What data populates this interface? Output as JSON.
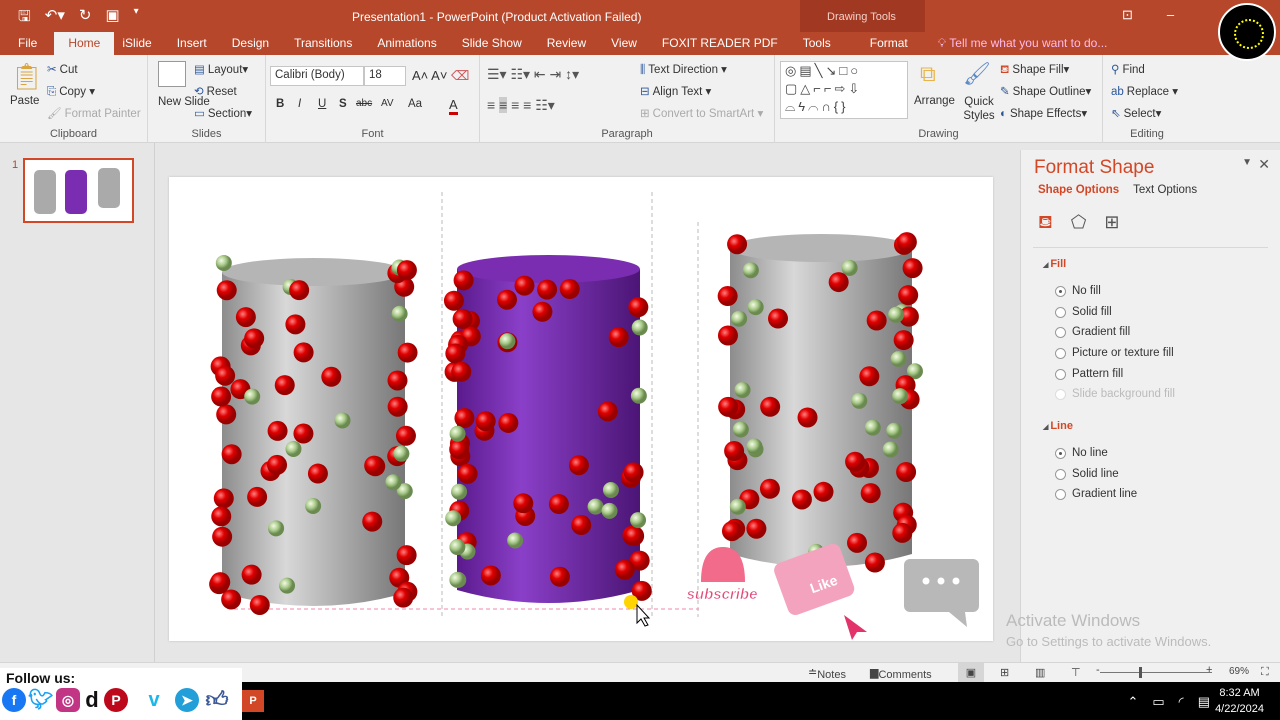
{
  "window": {
    "title": "Presentation1 - PowerPoint (Product Activation Failed)",
    "context_tab_group": "Drawing Tools"
  },
  "tabs": [
    "File",
    "Home",
    "iSlide",
    "Insert",
    "Design",
    "Transitions",
    "Animations",
    "Slide Show",
    "Review",
    "View",
    "FOXIT READER PDF",
    "Tools",
    "Format"
  ],
  "active_tab": "Home",
  "tell_me": "Tell me what you want to do...",
  "ribbon": {
    "clipboard": {
      "label": "Clipboard",
      "paste": "Paste",
      "cut": "Cut",
      "copy": "Copy",
      "format_painter": "Format Painter"
    },
    "slides": {
      "label": "Slides",
      "new_slide": "New Slide",
      "layout": "Layout",
      "reset": "Reset",
      "section": "Section"
    },
    "font": {
      "label": "Font",
      "font_name": "Calibri (Body)",
      "font_size": "18",
      "bold": "B",
      "italic": "I",
      "underline": "U",
      "shadow": "S",
      "strike": "abc",
      "spacing": "AV",
      "case": "Aa",
      "color": "A"
    },
    "paragraph": {
      "label": "Paragraph",
      "text_direction": "Text Direction",
      "align_text": "Align Text",
      "convert_smartart": "Convert to SmartArt"
    },
    "drawing": {
      "label": "Drawing",
      "arrange": "Arrange",
      "quick_styles": "Quick Styles",
      "shape_fill": "Shape Fill",
      "shape_outline": "Shape Outline",
      "shape_effects": "Shape Effects"
    },
    "editing": {
      "label": "Editing",
      "find": "Find",
      "replace": "Replace",
      "select": "Select"
    }
  },
  "thumbnails": [
    {
      "number": "1"
    }
  ],
  "slide": {
    "subscribe": "subscribe",
    "like": "Like",
    "cylinder_colors": [
      "#a9a9a9",
      "#7a2db0",
      "#a9a9a9"
    ]
  },
  "format_panel": {
    "title": "Format Shape",
    "tabs": [
      "Shape Options",
      "Text Options"
    ],
    "active_tab": "Shape Options",
    "fill": {
      "label": "Fill",
      "options": [
        "No fill",
        "Solid fill",
        "Gradient fill",
        "Picture or texture fill",
        "Pattern fill",
        "Slide background fill"
      ],
      "selected": "No fill",
      "disabled": [
        "Slide background fill"
      ]
    },
    "line": {
      "label": "Line",
      "options": [
        "No line",
        "Solid line",
        "Gradient line"
      ],
      "selected": "No line"
    }
  },
  "watermark": {
    "line1": "Activate Windows",
    "line2": "Go to Settings to activate Windows."
  },
  "statusbar": {
    "notes": "Notes",
    "comments": "Comments",
    "zoom": "69%"
  },
  "overlay": {
    "follow": "Follow us:",
    "networks": [
      "facebook",
      "twitter",
      "instagram",
      "dailymotion",
      "pinterest",
      "vimeo",
      "telegram",
      "like"
    ]
  },
  "taskbar": {
    "time": "8:32 AM",
    "date": "4/22/2024"
  },
  "colors": {
    "accent": "#b7472a",
    "panel_accent": "#d24726"
  }
}
